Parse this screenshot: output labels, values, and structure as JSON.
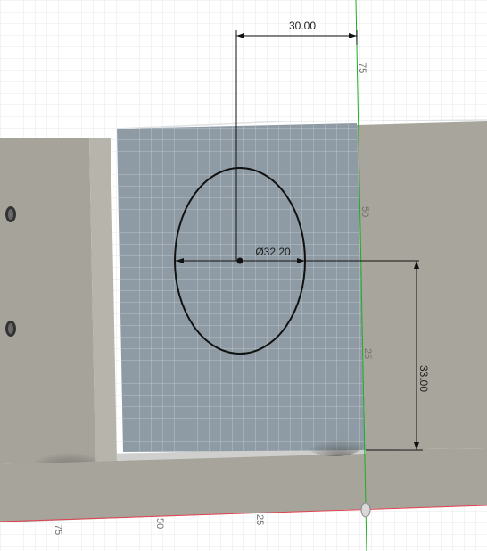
{
  "app": {
    "title": ""
  },
  "sketch": {
    "top_dimension": "30.00",
    "diameter_dimension": "Ø32.20",
    "right_dimension": "33.00"
  },
  "axis_labels": {
    "green_axis": [
      "75",
      "50",
      "25"
    ],
    "red_axis": [
      "75",
      "50",
      "25"
    ]
  },
  "colors": {
    "background": "#ffffff",
    "grid_line": "#e8ecef",
    "sketch_plane": "#8c99a2",
    "body_face": "#a7a49b",
    "green_axis": "#1fae1f",
    "red_axis": "#e0404e",
    "sketch_line": "#111111"
  }
}
